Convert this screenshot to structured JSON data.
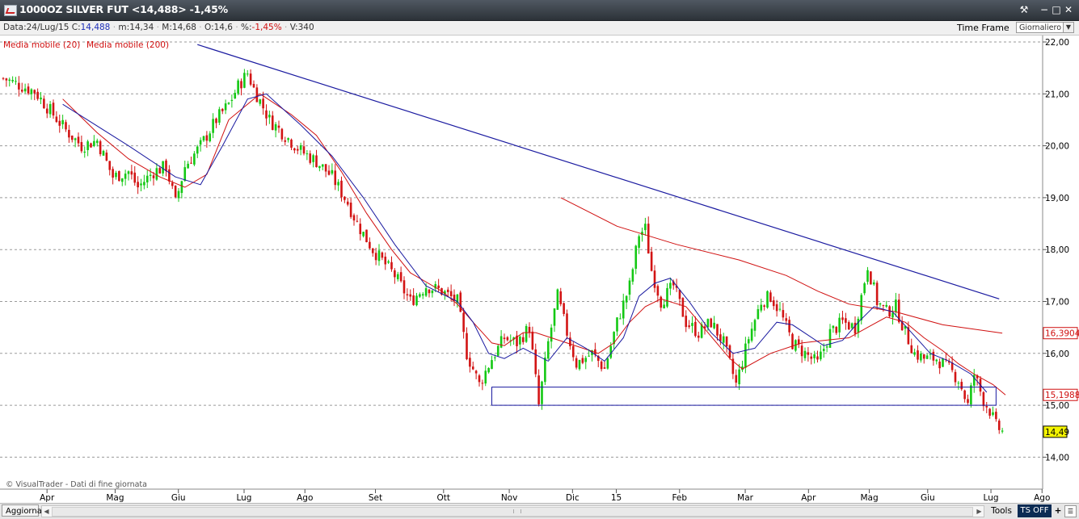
{
  "window": {
    "title": "1000OZ SILVER FUT <14,488> -1,45%",
    "buttons": [
      "tools",
      "minimize",
      "maximize",
      "close"
    ]
  },
  "infobar": {
    "date_label": "Data:",
    "date": "24/Lug/15",
    "close_label": "C:",
    "close": "14,488",
    "min_label": "m:",
    "min": "14,34",
    "max_label": "M:",
    "max": "14,68",
    "open_label": "O:",
    "open": "14,6",
    "change_label": "%:",
    "change": "-1,45%",
    "volume_label": "V:",
    "volume": "340",
    "timeframe_label": "Time Frame",
    "timeframe_value": "Giornaliero"
  },
  "bottombar": {
    "refresh_label": "Aggiorna",
    "tools_label": "Tools",
    "ts_label": "TS OFF",
    "plus_label": "+"
  },
  "chart_data": {
    "type": "candlestick",
    "indicators": [
      {
        "name": "Media mobile (20)",
        "color": "#1a1aa0"
      },
      {
        "name": "Media mobile (200)",
        "color": "#d01010"
      }
    ],
    "y_axis": {
      "ticks": [
        "22,00",
        "21,00",
        "20,00",
        "19,00",
        "18,00",
        "17,00",
        "16,00",
        "15,00",
        "14,00"
      ],
      "ylim": [
        13.5,
        22.1
      ],
      "position": "right",
      "grid": "dotted"
    },
    "x_axis": {
      "labels": [
        "Apr",
        "Mag",
        "Giu",
        "Lug",
        "Ago",
        "Set",
        "Ott",
        "Nov",
        "Dic",
        "15",
        "Feb",
        "Mar",
        "Apr",
        "Mag",
        "Giu",
        "Lug",
        "Ago"
      ]
    },
    "price_labels": [
      {
        "text": "16,3904",
        "value": 16.39,
        "color": "#d01010",
        "style": "outlined"
      },
      {
        "text": "15,1988",
        "value": 15.2,
        "color": "#d01010",
        "style": "outlined"
      },
      {
        "text": "14,49",
        "value": 14.49,
        "color": "#000000",
        "style": "highlight"
      }
    ],
    "watermark": "© VisualTrader - Dati di fine giornata",
    "candle_colors": {
      "up": "#14c814",
      "down": "#d21414"
    },
    "price_path": [
      [
        0,
        21.3
      ],
      [
        10,
        21.05
      ],
      [
        20,
        20.3
      ],
      [
        25,
        20.0
      ],
      [
        30,
        20.1
      ],
      [
        35,
        19.4
      ],
      [
        40,
        19.5
      ],
      [
        43,
        19.2
      ],
      [
        48,
        19.5
      ],
      [
        52,
        19.6
      ],
      [
        55,
        18.9
      ],
      [
        58,
        19.6
      ],
      [
        63,
        20.0
      ],
      [
        68,
        20.5
      ],
      [
        72,
        20.8
      ],
      [
        75,
        21.15
      ],
      [
        78,
        21.4
      ],
      [
        80,
        21.1
      ],
      [
        85,
        20.5
      ],
      [
        90,
        20.2
      ],
      [
        95,
        19.9
      ],
      [
        100,
        19.7
      ],
      [
        105,
        19.4
      ],
      [
        110,
        18.9
      ],
      [
        113,
        18.5
      ],
      [
        118,
        18.0
      ],
      [
        125,
        17.5
      ],
      [
        130,
        17.0
      ],
      [
        135,
        17.3
      ],
      [
        140,
        17.2
      ],
      [
        145,
        17.0
      ],
      [
        148,
        16.0
      ],
      [
        152,
        15.4
      ],
      [
        156,
        15.9
      ],
      [
        160,
        16.3
      ],
      [
        164,
        16.2
      ],
      [
        168,
        16.5
      ],
      [
        171,
        15.0
      ],
      [
        174,
        16.2
      ],
      [
        177,
        17.1
      ],
      [
        180,
        16.4
      ],
      [
        183,
        15.8
      ],
      [
        188,
        16.0
      ],
      [
        192,
        15.7
      ],
      [
        196,
        16.6
      ],
      [
        200,
        17.3
      ],
      [
        203,
        18.3
      ],
      [
        205,
        18.4
      ],
      [
        207,
        17.6
      ],
      [
        210,
        17.0
      ],
      [
        214,
        17.3
      ],
      [
        218,
        16.6
      ],
      [
        222,
        16.4
      ],
      [
        226,
        16.6
      ],
      [
        230,
        16.2
      ],
      [
        234,
        15.4
      ],
      [
        238,
        16.3
      ],
      [
        242,
        17.0
      ],
      [
        245,
        17.1
      ],
      [
        248,
        16.8
      ],
      [
        252,
        16.2
      ],
      [
        256,
        16.0
      ],
      [
        260,
        15.8
      ],
      [
        264,
        16.4
      ],
      [
        268,
        16.6
      ],
      [
        272,
        16.5
      ],
      [
        276,
        17.7
      ],
      [
        279,
        17.0
      ],
      [
        282,
        16.8
      ],
      [
        285,
        16.9
      ],
      [
        288,
        16.4
      ],
      [
        291,
        16.0
      ],
      [
        294,
        15.9
      ],
      [
        298,
        15.9
      ],
      [
        302,
        15.7
      ],
      [
        305,
        15.5
      ],
      [
        308,
        15.0
      ],
      [
        310,
        15.6
      ],
      [
        313,
        15.1
      ],
      [
        315,
        14.9
      ],
      [
        317,
        14.6
      ],
      [
        319,
        14.49
      ]
    ],
    "ma20_path": [
      [
        19,
        20.8
      ],
      [
        40,
        20.0
      ],
      [
        55,
        19.4
      ],
      [
        63,
        19.25
      ],
      [
        70,
        20.0
      ],
      [
        78,
        20.9
      ],
      [
        84,
        21.0
      ],
      [
        95,
        20.4
      ],
      [
        105,
        19.8
      ],
      [
        115,
        19.0
      ],
      [
        125,
        18.1
      ],
      [
        135,
        17.3
      ],
      [
        145,
        17.0
      ],
      [
        150,
        16.6
      ],
      [
        155,
        16.0
      ],
      [
        160,
        15.9
      ],
      [
        166,
        16.1
      ],
      [
        174,
        15.85
      ],
      [
        180,
        16.3
      ],
      [
        186,
        16.1
      ],
      [
        192,
        15.85
      ],
      [
        198,
        16.3
      ],
      [
        203,
        17.1
      ],
      [
        208,
        17.35
      ],
      [
        213,
        17.45
      ],
      [
        219,
        17.0
      ],
      [
        226,
        16.4
      ],
      [
        233,
        16.0
      ],
      [
        240,
        16.1
      ],
      [
        247,
        16.6
      ],
      [
        252,
        16.55
      ],
      [
        257,
        16.35
      ],
      [
        262,
        16.15
      ],
      [
        268,
        16.25
      ],
      [
        273,
        16.6
      ],
      [
        278,
        16.9
      ],
      [
        284,
        16.8
      ],
      [
        290,
        16.4
      ],
      [
        296,
        16.0
      ],
      [
        302,
        15.85
      ],
      [
        309,
        15.6
      ],
      [
        314,
        15.25
      ]
    ],
    "ma200_path": [
      [
        19,
        20.9
      ],
      [
        30,
        20.25
      ],
      [
        40,
        19.75
      ],
      [
        50,
        19.4
      ],
      [
        58,
        19.2
      ],
      [
        65,
        19.45
      ],
      [
        72,
        20.5
      ],
      [
        82,
        21.0
      ],
      [
        92,
        20.6
      ],
      [
        100,
        20.2
      ],
      [
        108,
        19.5
      ],
      [
        116,
        18.7
      ],
      [
        124,
        18.0
      ],
      [
        130,
        17.55
      ],
      [
        140,
        17.2
      ],
      [
        145,
        16.95
      ],
      [
        150,
        16.6
      ],
      [
        156,
        16.2
      ],
      [
        160,
        16.15
      ],
      [
        166,
        16.4
      ],
      [
        170,
        16.4
      ],
      [
        180,
        16.2
      ],
      [
        190,
        16.0
      ],
      [
        195,
        16.2
      ],
      [
        200,
        16.6
      ],
      [
        205,
        16.9
      ],
      [
        210,
        17.05
      ],
      [
        218,
        16.9
      ],
      [
        225,
        16.4
      ],
      [
        232,
        15.9
      ],
      [
        236,
        15.7
      ],
      [
        245,
        16.0
      ],
      [
        255,
        16.2
      ],
      [
        262,
        16.25
      ],
      [
        270,
        16.3
      ],
      [
        276,
        16.5
      ],
      [
        282,
        16.7
      ],
      [
        288,
        16.6
      ],
      [
        294,
        16.3
      ],
      [
        300,
        16.05
      ],
      [
        305,
        15.8
      ],
      [
        310,
        15.6
      ],
      [
        316,
        15.4
      ],
      [
        320,
        15.2
      ]
    ],
    "ma200_path_late": [
      [
        178,
        19.0
      ],
      [
        196,
        18.45
      ],
      [
        215,
        18.1
      ],
      [
        235,
        17.8
      ],
      [
        250,
        17.5
      ],
      [
        260,
        17.2
      ],
      [
        270,
        16.95
      ],
      [
        285,
        16.8
      ],
      [
        300,
        16.55
      ],
      [
        319,
        16.39
      ]
    ],
    "trendline": {
      "from": [
        62,
        21.95
      ],
      "to": [
        318,
        17.05
      ],
      "color": "#1a1aa0"
    },
    "support_box": {
      "x0": 156,
      "x1": 317,
      "y_top": 15.35,
      "y_bottom": 15.0,
      "color": "#1a1aa0"
    }
  }
}
